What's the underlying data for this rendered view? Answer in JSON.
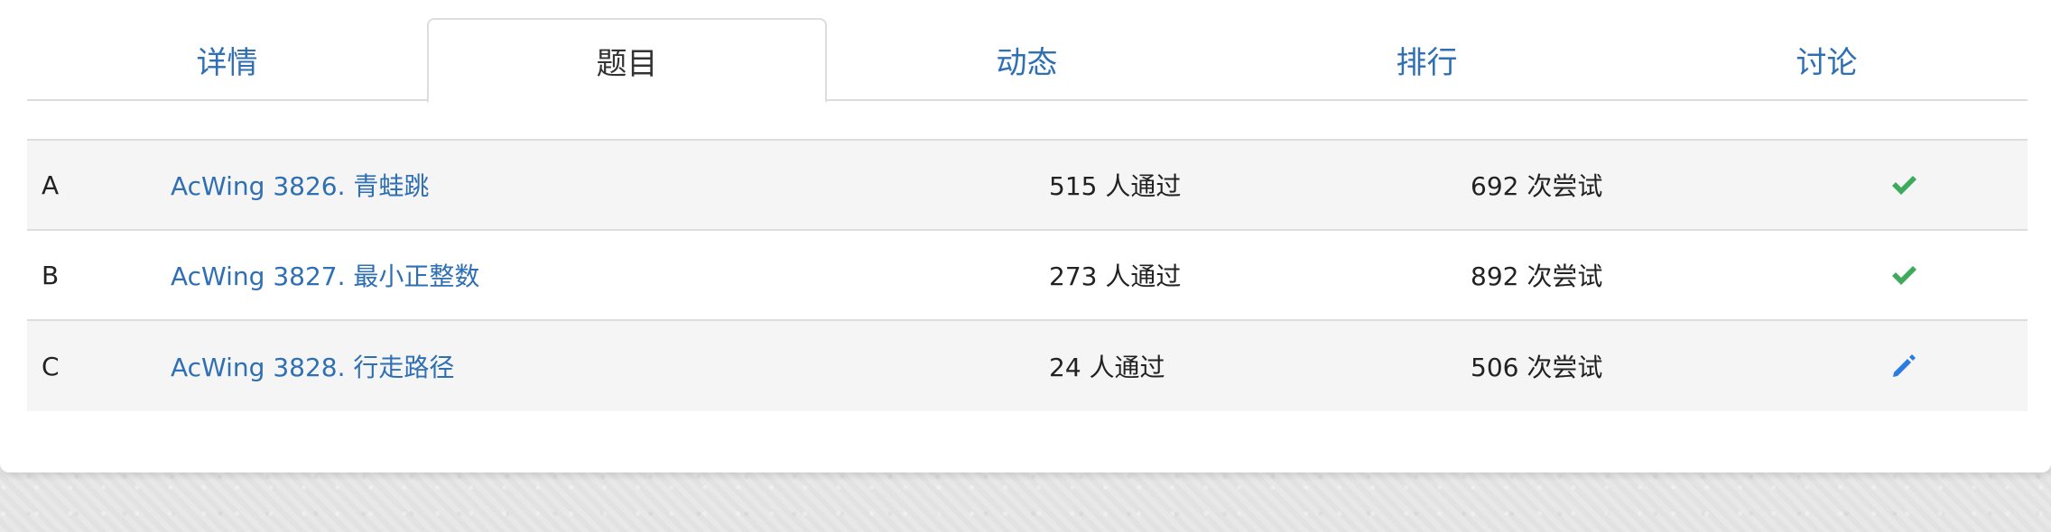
{
  "tabs": [
    {
      "label": "详情",
      "active": false
    },
    {
      "label": "题目",
      "active": true
    },
    {
      "label": "动态",
      "active": false
    },
    {
      "label": "排行",
      "active": false
    },
    {
      "label": "讨论",
      "active": false
    }
  ],
  "problems": [
    {
      "letter": "A",
      "title": "AcWing 3826. 青蛙跳",
      "passed": "515 人通过",
      "attempts": "692 次尝试",
      "status": "check-icon"
    },
    {
      "letter": "B",
      "title": "AcWing 3827. 最小正整数",
      "passed": "273 人通过",
      "attempts": "892 次尝试",
      "status": "check-icon"
    },
    {
      "letter": "C",
      "title": "AcWing 3828. 行走路径",
      "passed": "24 人通过",
      "attempts": "506 次尝试",
      "status": "pencil-icon"
    }
  ],
  "colors": {
    "link": "#2f6fb3",
    "check": "#3daa5c",
    "pencil": "#2a7be4",
    "border": "#dddddd",
    "row_alt": "#f5f5f5"
  }
}
